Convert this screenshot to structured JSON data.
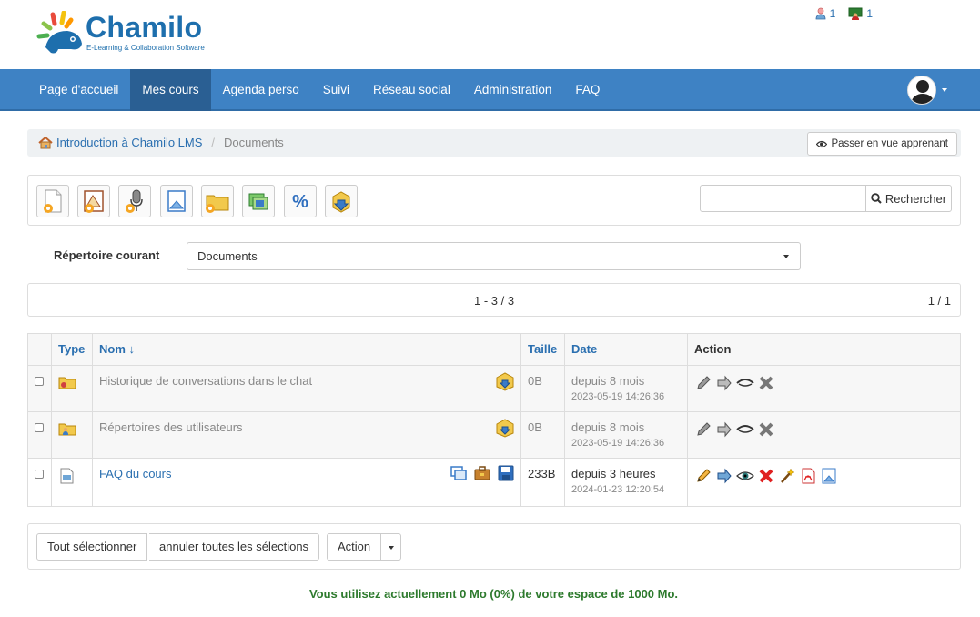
{
  "header": {
    "logo_text": "Chamilo",
    "logo_subtitle": "E-Learning & Collaboration Software",
    "users_online_count": "1",
    "users_in_course_count": "1"
  },
  "nav": {
    "items": [
      {
        "label": "Page d'accueil"
      },
      {
        "label": "Mes cours",
        "active": true
      },
      {
        "label": "Agenda perso"
      },
      {
        "label": "Suivi"
      },
      {
        "label": "Réseau social"
      },
      {
        "label": "Administration"
      },
      {
        "label": "FAQ"
      }
    ]
  },
  "breadcrumb": {
    "course": "Introduction à Chamilo LMS",
    "separator": "/",
    "current": "Documents",
    "view_button": "Passer en vue apprenant"
  },
  "toolbar": {
    "icons": [
      "new-document-icon",
      "new-template-icon",
      "record-audio-icon",
      "upload-icon",
      "new-folder-icon",
      "slideshow-icon",
      "quota-icon",
      "download-all-icon"
    ],
    "search_placeholder": "",
    "search_button": "Rechercher"
  },
  "current_dir": {
    "label": "Répertoire courant",
    "value": "Documents"
  },
  "pager": {
    "range": "1 - 3 / 3",
    "pages": "1 / 1"
  },
  "table": {
    "headers": {
      "type": "Type",
      "name": "Nom ↓",
      "size": "Taille",
      "date": "Date",
      "action": "Action"
    },
    "rows": [
      {
        "name": "Historique de conversations dans le chat",
        "size": "0B",
        "date": "depuis 8 mois",
        "timestamp": "2023-05-19 14:26:36"
      },
      {
        "name": "Répertoires des utilisateurs",
        "size": "0B",
        "date": "depuis 8 mois",
        "timestamp": "2023-05-19 14:26:36"
      },
      {
        "name": "FAQ du cours",
        "size": "233B",
        "date": "depuis 3 heures",
        "timestamp": "2024-01-23 12:20:54"
      }
    ]
  },
  "bottom": {
    "select_all": "Tout sélectionner",
    "unselect_all": "annuler toutes les sélections",
    "action": "Action"
  },
  "quota_message": "Vous utilisez actuellement 0 Mo (0%) de votre espace de 1000 Mo.",
  "colors": {
    "navbar": "#3e82c4",
    "navbar_active": "#2a5f93",
    "link": "#2a6fb0",
    "quota_text": "#2d7a2d"
  }
}
